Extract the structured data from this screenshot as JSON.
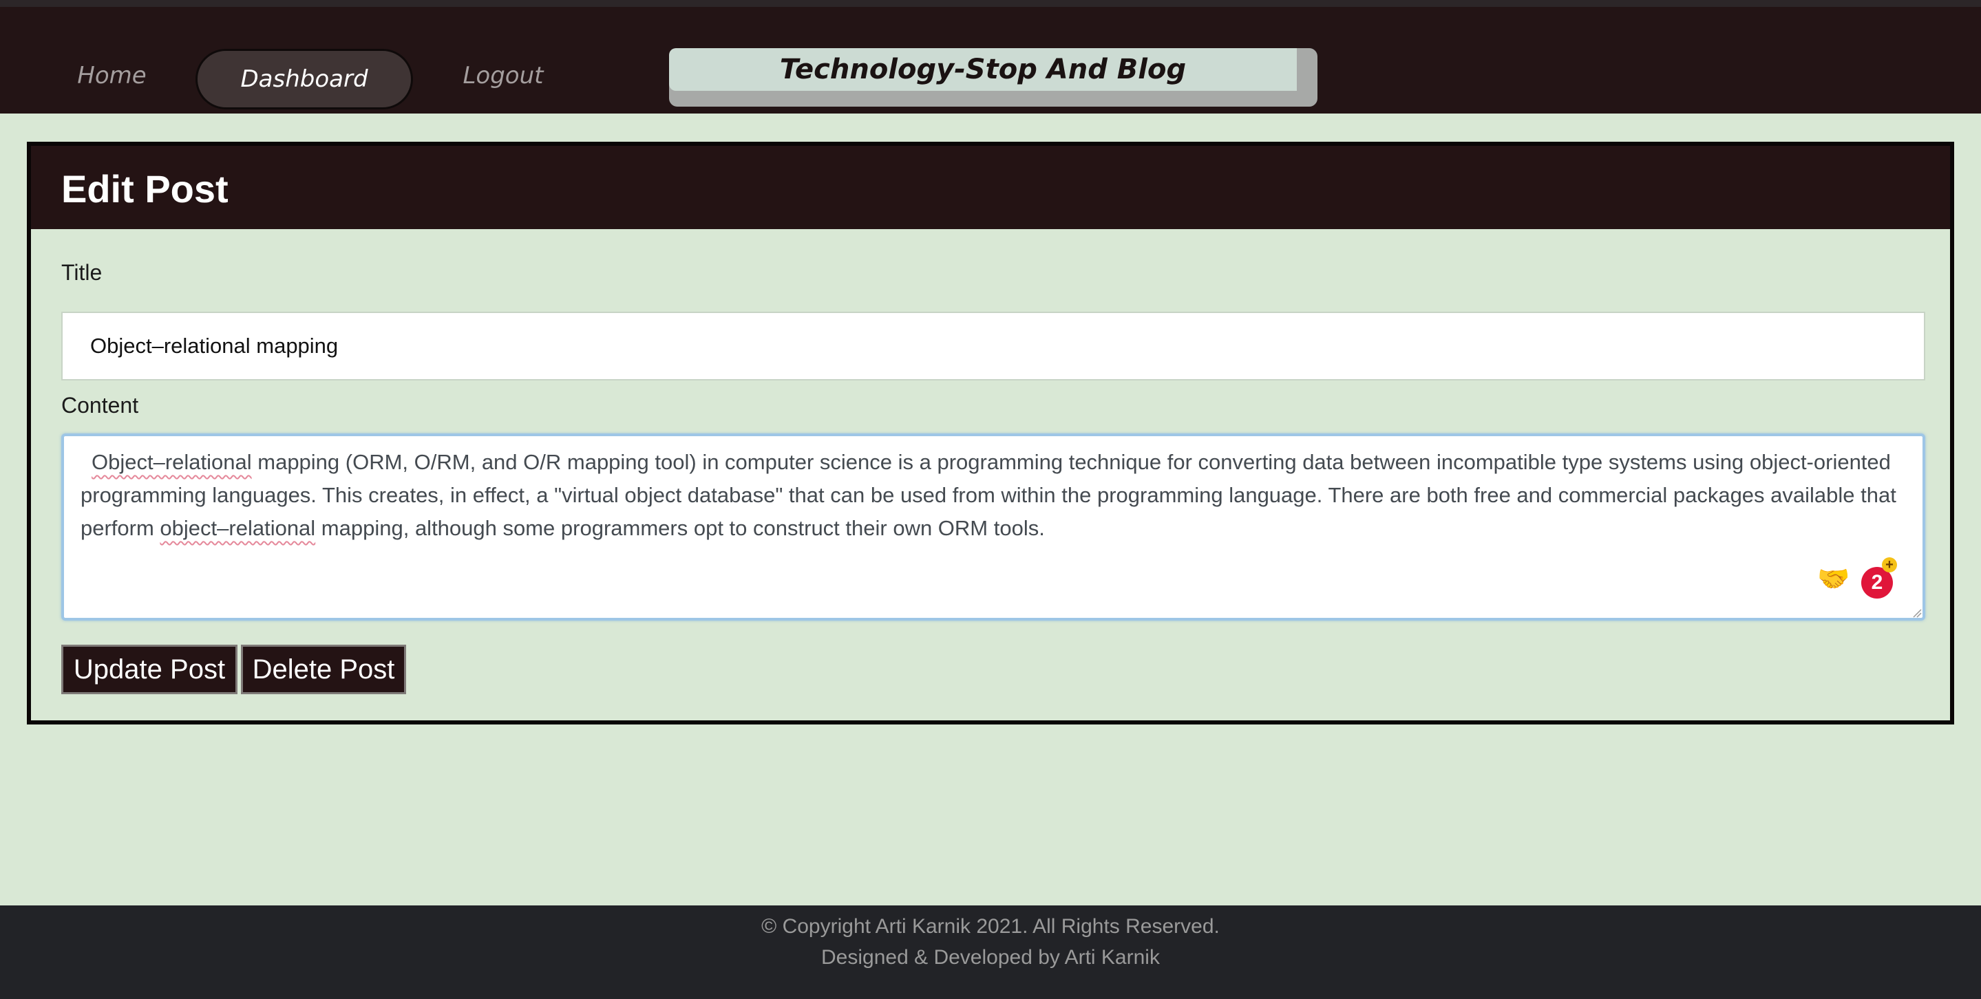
{
  "nav": {
    "home_label": "Home",
    "dashboard_label": "Dashboard",
    "logout_label": "Logout",
    "brand": "Technology-Stop And Blog"
  },
  "edit": {
    "heading": "Edit Post",
    "title_label": "Title",
    "title_value": "Object–relational mapping",
    "content_label": "Content",
    "content_lines": [
      "Object–relational",
      " mapping (ORM, O/RM, and O/R mapping tool) in computer science is a programming technique for converting data between incompatible type systems using object-oriented programming languages. This creates, in effect, a \"virtual object database\" that can be used from within the programming language. There are both free and commercial packages available that perform ",
      "object–relational",
      " mapping, although some programmers opt to construct their own ORM tools."
    ],
    "update_label": "Update Post",
    "delete_label": "Delete Post"
  },
  "extension": {
    "icon": "handshake-icon",
    "badge_count": "2",
    "badge_plus": "+"
  },
  "footer": {
    "copyright": "© Copyright Arti Karnik 2021. All Rights Reserved.",
    "credit": "Designed & Developed by Arti Karnik"
  },
  "colors": {
    "page_bg": "#d9e8d5",
    "nav_bg": "#231415",
    "card_header_bg": "#241314",
    "button_bg": "#241314",
    "footer_bg": "#222327",
    "brand_bg": "#ccdbd3",
    "badge_red": "#e0163a"
  }
}
